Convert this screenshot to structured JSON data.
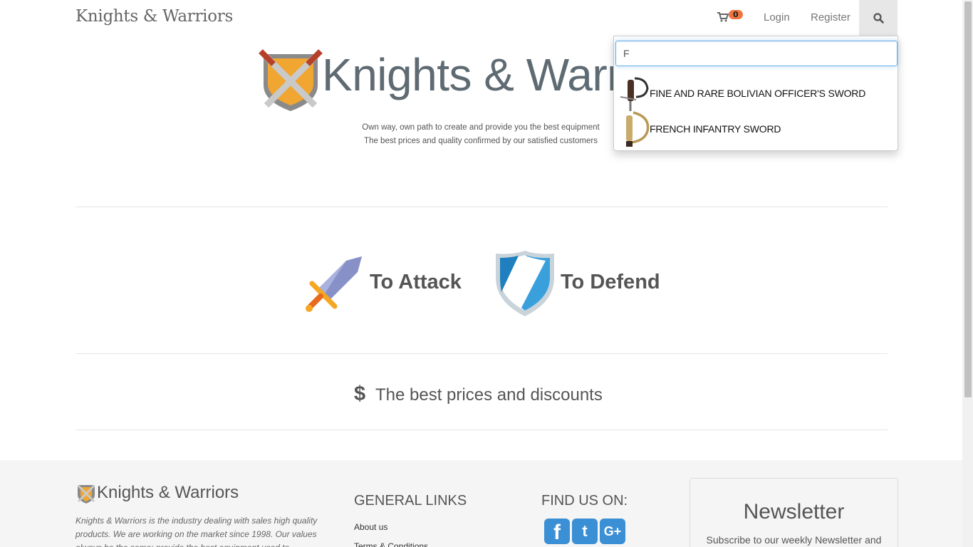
{
  "navbar": {
    "brand": "Knights & Warriors",
    "cart_count": "0",
    "login": "Login",
    "register": "Register"
  },
  "search": {
    "query": "F",
    "results": [
      {
        "label": "FINE AND RARE BOLIVIAN OFFICER'S SWORD",
        "icon": "sword-thumbnail-icon"
      },
      {
        "label": "FRENCH INFANTRY SWORD",
        "icon": "sword-thumbnail-icon"
      }
    ]
  },
  "hero": {
    "title": "Knights & Warriors",
    "subtitle_1": "Own way, own path to create and provide you the best equipment",
    "subtitle_2": "The best prices and quality confirmed by our satisfied customers"
  },
  "features": {
    "attack": "To Attack",
    "defend": "To Defend",
    "price_icon": "$",
    "price_text": "The best prices and discounts"
  },
  "footer": {
    "brand": "Knights & Warriors",
    "description": "Knights & Warriors is the industry dealing with sales high quality products. We are working on the market since 1998. Our values always be the same: provide the best equipment used to",
    "general_links_heading": "GENERAL LINKS",
    "links": [
      "About us",
      "Terms & Conditions"
    ],
    "find_us_heading": "FIND US ON:",
    "social": [
      "f",
      "t",
      "G+"
    ],
    "newsletter_title": "Newsletter",
    "newsletter_text": "Subscribe to our weekly Newsletter and"
  },
  "colors": {
    "accent": "#3b8fd5",
    "badge": "#f0743e",
    "footer_bg": "#f5f5f5"
  }
}
